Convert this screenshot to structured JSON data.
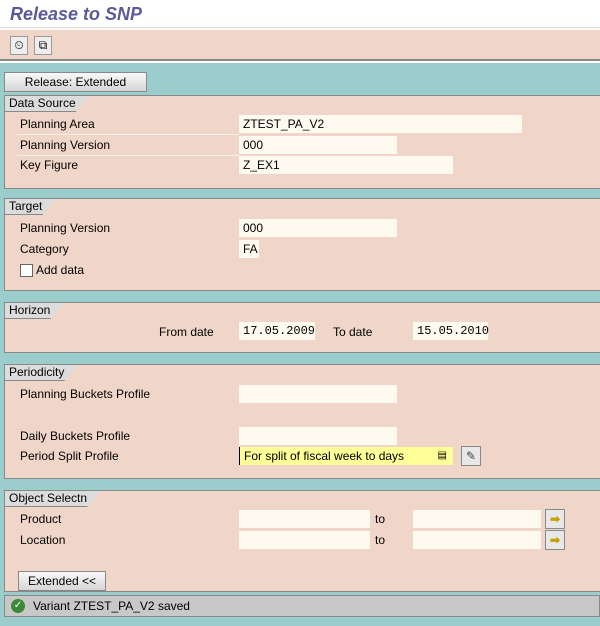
{
  "title": "Release to SNP",
  "toolbar": {
    "icons": [
      "execute-icon",
      "variant-icon"
    ]
  },
  "release_button": "Release: Extended",
  "data_source": {
    "title": "Data Source",
    "planning_area": {
      "label": "Planning Area",
      "value": "ZTEST_PA_V2"
    },
    "planning_version": {
      "label": "Planning Version",
      "value": "000"
    },
    "key_figure": {
      "label": "Key Figure",
      "value": "Z_EX1"
    }
  },
  "target": {
    "title": "Target",
    "planning_version": {
      "label": "Planning Version",
      "value": "000"
    },
    "category": {
      "label": "Category",
      "value": "FA"
    },
    "add_data": {
      "label": "Add data",
      "checked": false
    }
  },
  "horizon": {
    "title": "Horizon",
    "from_label": "From date",
    "from_value": "17.05.2009",
    "to_label": "To date",
    "to_value": "15.05.2010"
  },
  "periodicity": {
    "title": "Periodicity",
    "planning_buckets": {
      "label": "Planning Buckets Profile",
      "value": ""
    },
    "daily_buckets": {
      "label": "Daily Buckets Profile",
      "value": ""
    },
    "period_split": {
      "label": "Period Split Profile",
      "value": "For split of fiscal week to days"
    }
  },
  "object_selection": {
    "title": "Object Selectn",
    "product": {
      "label": "Product",
      "from": "",
      "to_label": "to",
      "to": ""
    },
    "location": {
      "label": "Location",
      "from": "",
      "to_label": "to",
      "to": ""
    }
  },
  "extended_button": "Extended <<",
  "status": "Variant ZTEST_PA_V2 saved",
  "colors": {
    "panel": "#f0d6c8",
    "background": "#9ccdcd",
    "highlight": "#ffff99"
  }
}
